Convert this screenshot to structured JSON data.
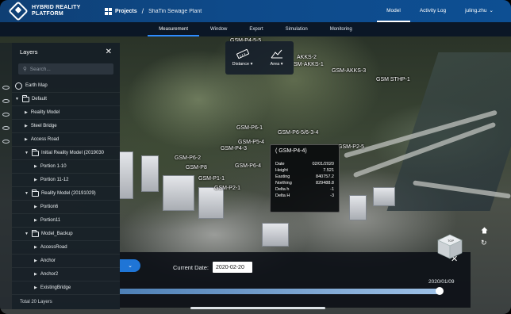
{
  "app": {
    "logo_line1": "HYBRID REALITY",
    "logo_line2": "PLATFORM"
  },
  "breadcrumb": {
    "projects": "Projects",
    "separator": "/",
    "project": "ShaTin Sewage Plant"
  },
  "topnav": {
    "model": "Model",
    "activity_log": "Activity Log",
    "user": "juling.zhu"
  },
  "menu": [
    {
      "label": "Measurement",
      "active": true
    },
    {
      "label": "Window",
      "active": false
    },
    {
      "label": "Export",
      "active": false
    },
    {
      "label": "Simulation",
      "active": false
    },
    {
      "label": "Monitoring",
      "active": false
    }
  ],
  "tools": {
    "distance": "Distance",
    "area": "Area"
  },
  "map_labels": {
    "l1": "GSM-P4-5-5",
    "l2": "AKKS-2",
    "l3": "SM-AKKS-1",
    "l4": "GSM-AKKS-3",
    "l5": "GSM STHP-1",
    "l6": "GSM-P6-1",
    "l7": "GSM-P6-5/6-3-4",
    "l8": "GSM-P5-4",
    "l9": "GSM-P4-3",
    "l10": "GSM-P2-5",
    "l11": "GSM-P6-2",
    "l12": "GSM-P8",
    "l13": "GSM-P6-4",
    "l14": "GSM-P1-1",
    "l15": "GSM-P2-1"
  },
  "info_popup": {
    "title": "( GSM-P4-4)",
    "rows": [
      {
        "label": "Date",
        "value": "02/01/2020"
      },
      {
        "label": "Height",
        "value": "7.521"
      },
      {
        "label": "Easting",
        "value": "840757.2"
      },
      {
        "label": "Northing",
        "value": "829488.8"
      },
      {
        "label": "Delta h",
        "value": "-1"
      },
      {
        "label": "Delta H",
        "value": "-3"
      }
    ]
  },
  "layers": {
    "title": "Layers",
    "search_placeholder": "Search...",
    "items": [
      {
        "label": "Earth Map"
      },
      {
        "label": "Default"
      },
      {
        "label": "Reality Model"
      },
      {
        "label": "Steel Bridge"
      },
      {
        "label": "Access Road"
      },
      {
        "label": "Initial Reality Model (2019030"
      },
      {
        "label": "Portion 1-10"
      },
      {
        "label": "Portion 11-12"
      },
      {
        "label": "Reality Model (20191029)"
      },
      {
        "label": "Portion6"
      },
      {
        "label": "Portion11"
      },
      {
        "label": "Model_Backup"
      },
      {
        "label": "AccessRoad"
      },
      {
        "label": "Anchor"
      },
      {
        "label": "Anchor2"
      },
      {
        "label": "ExistingBridge"
      }
    ],
    "footer": "Total 20 Layers"
  },
  "timeline": {
    "current_date_label": "Current Date:",
    "current_date_value": "2020-02-20",
    "end_date": "2020/01/09",
    "progress": 0.98
  },
  "navcube": {
    "top_face": "TOP"
  },
  "colors": {
    "accent": "#1f75d6",
    "topbar": "#0e4a8a"
  }
}
